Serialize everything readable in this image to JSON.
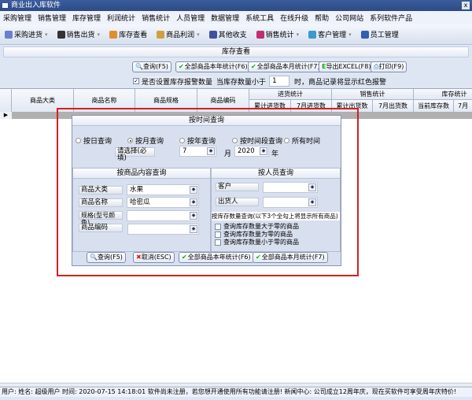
{
  "window": {
    "title": "商业出入库软件",
    "close": "x"
  },
  "menu": [
    "采购管理",
    "销售管理",
    "库存管理",
    "利润统计",
    "销售统计",
    "人员管理",
    "数据管理",
    "系统工具",
    "在线升级",
    "帮助",
    "公司网站",
    "系列软件产品"
  ],
  "toolbar": [
    {
      "label": "采购进货",
      "dropdown": true,
      "color": "#6a7fd0"
    },
    {
      "label": "销售出货",
      "dropdown": true,
      "color": "#333"
    },
    {
      "label": "库存查看",
      "dropdown": false,
      "color": "#e0902a"
    },
    {
      "label": "商品利润",
      "dropdown": true,
      "color": "#d0a040"
    },
    {
      "label": "其他收支",
      "dropdown": false,
      "color": "#4050a0"
    },
    {
      "label": "销售统计",
      "dropdown": true,
      "color": "#c03070"
    },
    {
      "label": "客户管理",
      "dropdown": true,
      "color": "#3a9ad0"
    },
    {
      "label": "员工管理",
      "dropdown": false,
      "color": "#3060b0"
    }
  ],
  "panel": {
    "title": "库存查看",
    "buttons": {
      "query": "查询(F5)",
      "year_all": "全部商品本年统计(F6)",
      "month_all": "全部商品本月统计(F7)",
      "export": "导出EXCEL(F8)",
      "print": "打印(F9)"
    },
    "alarm_checkbox": "是否设置库存报警数量",
    "alarm_checked": true,
    "alarm_prefix": "当库存数量小于",
    "alarm_value": "1",
    "alarm_suffix": "时，商品记录将显示红色报警"
  },
  "table": {
    "columns": [
      "商品大类",
      "商品名称",
      "商品规格",
      "商品编码"
    ],
    "groups": [
      {
        "label": "进货统计",
        "sub": [
          "累计进货数",
          "7月进货数"
        ]
      },
      {
        "label": "销售统计",
        "sub": [
          "累计出货数",
          "7月出货数"
        ]
      },
      {
        "label": "库存统计",
        "sub": [
          "当前库存数",
          "7月"
        ]
      }
    ],
    "row_marker": "▶"
  },
  "dialog": {
    "time_title": "按时间查询",
    "radios": [
      {
        "label": "按日查询",
        "checked": false
      },
      {
        "label": "按月查询",
        "checked": true
      },
      {
        "label": "按年查询",
        "checked": false
      },
      {
        "label": "按时间段查询",
        "checked": false
      },
      {
        "label": "所有时间",
        "checked": false
      }
    ],
    "select_label": "请选择(必填)",
    "month_value": "7",
    "month_unit": "月",
    "year_value": "2020",
    "year_unit": "年",
    "goods_title": "按商品内容查询",
    "goods_fields": [
      {
        "label": "商品大类",
        "value": "水果"
      },
      {
        "label": "商品名称",
        "value": "哈密瓜"
      },
      {
        "label": "规格(型号颜色)",
        "value": ""
      },
      {
        "label": "商品编码",
        "value": ""
      }
    ],
    "person_title": "按人员查询",
    "person_fields": [
      {
        "label": "客户",
        "value": ""
      },
      {
        "label": "出货人",
        "value": ""
      }
    ],
    "stock_title": "按库存数量查询(以下3个全勾上将显示所有商品)",
    "stock_checks": [
      {
        "label": "查询库存数量大于零的商品",
        "checked": false
      },
      {
        "label": "查询库存数量为零的商品",
        "checked": false
      },
      {
        "label": "查询库存数量小于零的商品",
        "checked": false
      }
    ],
    "buttons": {
      "query": "查询(F5)",
      "cancel": "取消(ESC)",
      "year_all": "全部商品本年统计(F6)",
      "month_all": "全部商品本月统计(F7)"
    }
  },
  "status": "用户:  姓名: 超级用户  时间: 2020-07-15 14:18:01 软件尚未注册，若您想开通使用所有功能请注册! 新闻中心: 公司成立12周年庆，现在买软件可享受周年庆特价!"
}
